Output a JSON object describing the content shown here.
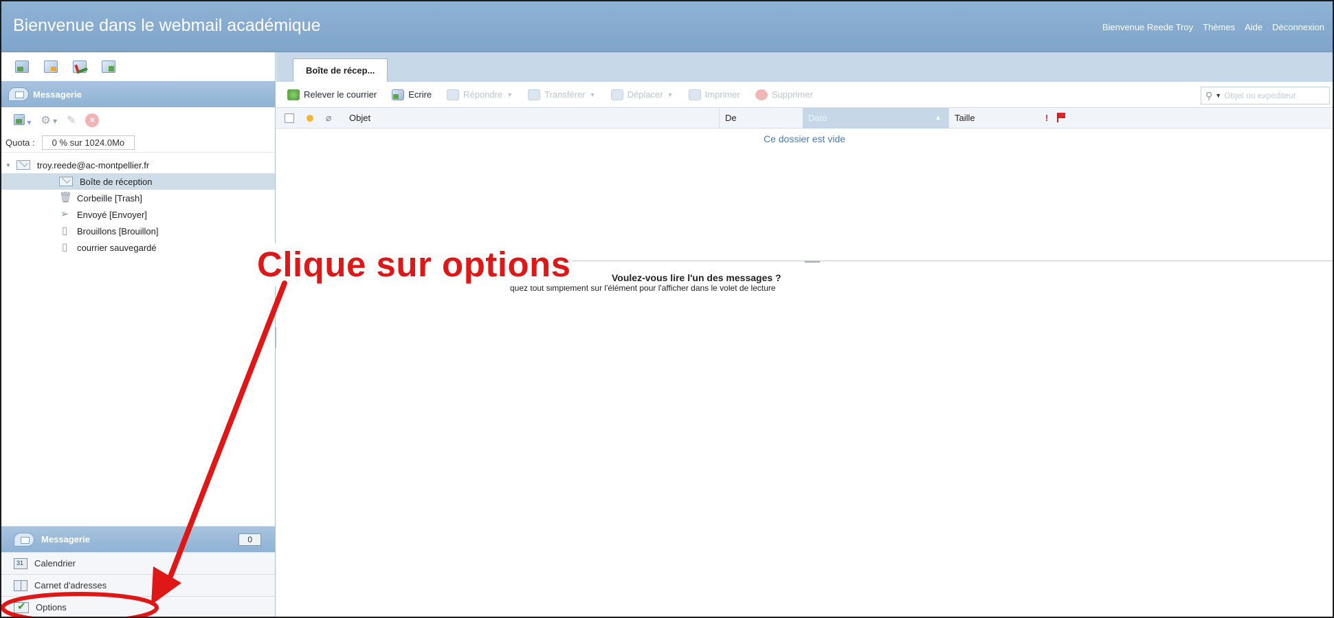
{
  "header": {
    "title": "Bienvenue dans le webmail académique",
    "links": {
      "welcome": "Bienvenue Reede Troy",
      "themes": "Thèmes",
      "help": "Aide",
      "logout": "Déconnexion"
    },
    "color": "#8fb2d4"
  },
  "sidebar": {
    "section_title": "Messagerie",
    "quota_label": "Quota :",
    "quota_value": "0 % sur 1024.0Mo",
    "account": "troy.reede@ac-montpellier.fr",
    "folders": [
      {
        "label": "Boîte de réception",
        "icon": "inbox-icon",
        "selected": true
      },
      {
        "label": "Corbeille [Trash]",
        "icon": "trash-icon",
        "selected": false
      },
      {
        "label": "Envoyé [Envoyer]",
        "icon": "sent-icon",
        "selected": false
      },
      {
        "label": "Brouillons [Brouillon]",
        "icon": "drafts-icon",
        "selected": false
      },
      {
        "label": "courrier sauvegardé",
        "icon": "saved-folder-icon",
        "selected": false
      }
    ]
  },
  "bottom_nav": {
    "messagerie": "Messagerie",
    "messagerie_count": "0",
    "calendrier": "Calendrier",
    "carnet": "Carnet d'adresses",
    "options": "Options"
  },
  "main": {
    "tab_label": "Boîte de récep...",
    "toolbar": {
      "relever": "Relever le courrier",
      "ecrire": "Ecrire",
      "repondre": "Répondre",
      "transferer": "Transférer",
      "deplacer": "Déplacer",
      "imprimer": "Imprimer",
      "supprimer": "Supprimer"
    },
    "search_placeholder": "Objet ou expéditeur",
    "columns": {
      "objet": "Objet",
      "de": "De",
      "date": "Date",
      "taille": "Taille",
      "priority": "!"
    },
    "empty_message": "Ce dossier est vide",
    "reading_title": "Voulez-vous lire l'un des messages ?",
    "reading_subtitle": "quez tout simplement sur l'élément pour l'afficher dans le volet de lecture"
  },
  "annotation": {
    "text": "Clique sur options",
    "color": "#e01717"
  }
}
